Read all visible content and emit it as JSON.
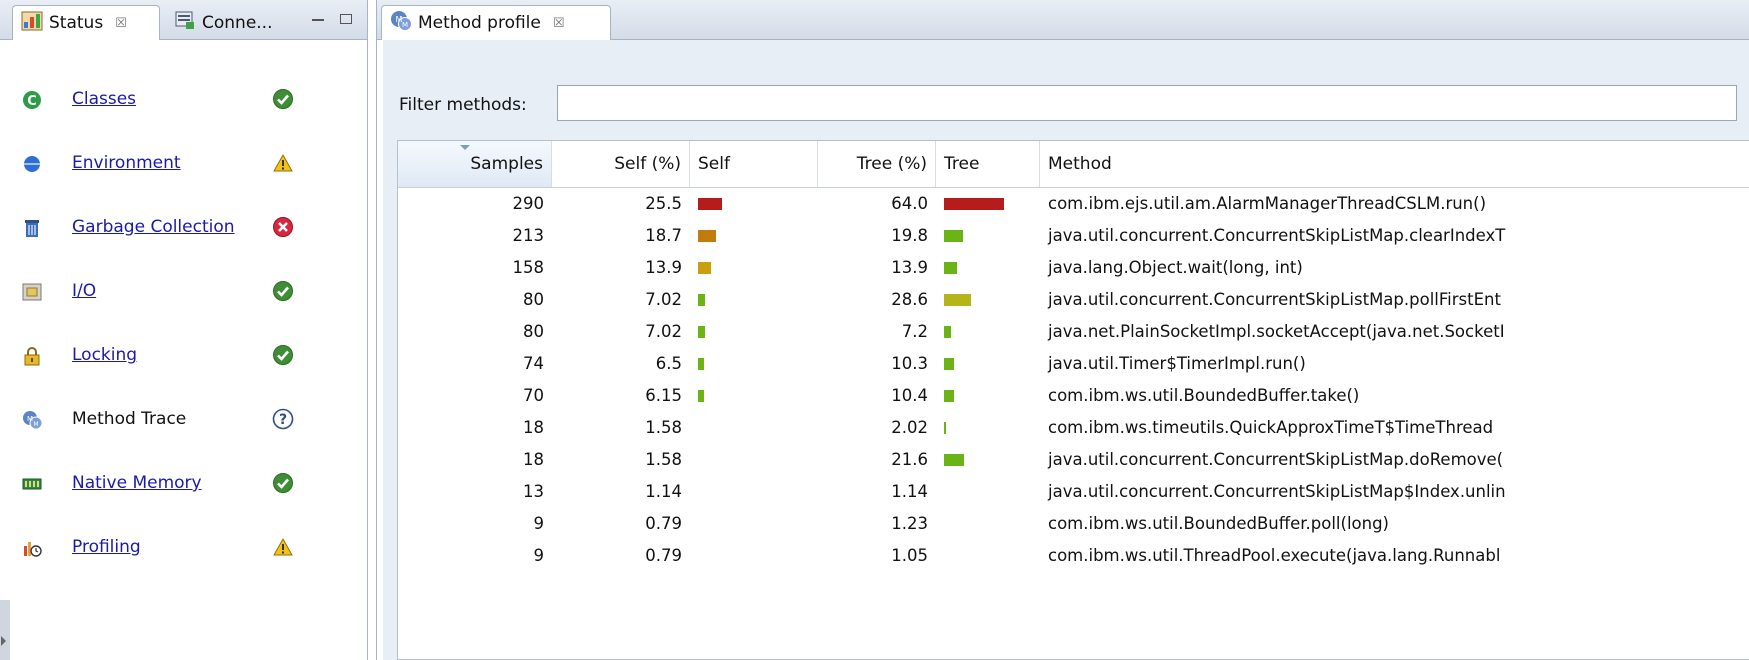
{
  "colors": {
    "bar_high": "#b71c1c",
    "bar_orange": "#c27c0e",
    "bar_gold": "#c9a00c",
    "bar_olive": "#b5b41a",
    "bar_green": "#6ab417"
  },
  "left_panel": {
    "tabs": [
      {
        "label": "Status",
        "close": "☒"
      },
      {
        "label": "Conne...",
        "close": ""
      }
    ],
    "items": [
      {
        "label": "Classes",
        "icon": "classes-icon",
        "status": "ok",
        "link": true
      },
      {
        "label": "Environment",
        "icon": "environment-icon",
        "status": "warning",
        "link": true
      },
      {
        "label": "Garbage Collection",
        "icon": "garbage-collection-icon",
        "status": "error",
        "link": true
      },
      {
        "label": "I/O",
        "icon": "io-icon",
        "status": "ok",
        "link": true
      },
      {
        "label": "Locking",
        "icon": "locking-icon",
        "status": "ok",
        "link": true
      },
      {
        "label": "Method Trace",
        "icon": "method-trace-icon",
        "status": "unknown",
        "link": false
      },
      {
        "label": "Native Memory",
        "icon": "native-memory-icon",
        "status": "ok",
        "link": true
      },
      {
        "label": "Profiling",
        "icon": "profiling-icon",
        "status": "warning",
        "link": true
      }
    ]
  },
  "right_panel": {
    "tab": {
      "label": "Method profile",
      "close": "☒"
    },
    "filter": {
      "label": "Filter methods:",
      "value": ""
    },
    "columns": [
      "Samples",
      "Self (%)",
      "Self",
      "Tree (%)",
      "Tree",
      "Method"
    ],
    "rows": [
      {
        "samples": "290",
        "self_pct": "25.5",
        "self_bar": 25.5,
        "self_color": "#b71c1c",
        "tree_pct": "64.0",
        "tree_bar": 64.0,
        "tree_color": "#b71c1c",
        "method": "com.ibm.ejs.util.am.AlarmManagerThreadCSLM.run()"
      },
      {
        "samples": "213",
        "self_pct": "18.7",
        "self_bar": 18.7,
        "self_color": "#c27c0e",
        "tree_pct": "19.8",
        "tree_bar": 19.8,
        "tree_color": "#6ab417",
        "method": "java.util.concurrent.ConcurrentSkipListMap.clearIndexT"
      },
      {
        "samples": "158",
        "self_pct": "13.9",
        "self_bar": 13.9,
        "self_color": "#c9a00c",
        "tree_pct": "13.9",
        "tree_bar": 13.9,
        "tree_color": "#6ab417",
        "method": "java.lang.Object.wait(long, int)"
      },
      {
        "samples": "80",
        "self_pct": "7.02",
        "self_bar": 7.02,
        "self_color": "#6ab417",
        "tree_pct": "28.6",
        "tree_bar": 28.6,
        "tree_color": "#b5b41a",
        "method": "java.util.concurrent.ConcurrentSkipListMap.pollFirstEnt"
      },
      {
        "samples": "80",
        "self_pct": "7.02",
        "self_bar": 7.02,
        "self_color": "#6ab417",
        "tree_pct": "7.2",
        "tree_bar": 7.2,
        "tree_color": "#6ab417",
        "method": "java.net.PlainSocketImpl.socketAccept(java.net.SocketI"
      },
      {
        "samples": "74",
        "self_pct": "6.5",
        "self_bar": 6.5,
        "self_color": "#6ab417",
        "tree_pct": "10.3",
        "tree_bar": 10.3,
        "tree_color": "#6ab417",
        "method": "java.util.Timer$TimerImpl.run()"
      },
      {
        "samples": "70",
        "self_pct": "6.15",
        "self_bar": 6.15,
        "self_color": "#6ab417",
        "tree_pct": "10.4",
        "tree_bar": 10.4,
        "tree_color": "#6ab417",
        "method": "com.ibm.ws.util.BoundedBuffer.take()"
      },
      {
        "samples": "18",
        "self_pct": "1.58",
        "self_bar": 0,
        "self_color": "#6ab417",
        "tree_pct": "2.02",
        "tree_bar": 2.02,
        "tree_color": "#6ab417",
        "method": "com.ibm.ws.timeutils.QuickApproxTimeT$TimeThread"
      },
      {
        "samples": "18",
        "self_pct": "1.58",
        "self_bar": 0,
        "self_color": "#6ab417",
        "tree_pct": "21.6",
        "tree_bar": 21.6,
        "tree_color": "#6ab417",
        "method": "java.util.concurrent.ConcurrentSkipListMap.doRemove("
      },
      {
        "samples": "13",
        "self_pct": "1.14",
        "self_bar": 0,
        "self_color": "#6ab417",
        "tree_pct": "1.14",
        "tree_bar": 0,
        "tree_color": "#6ab417",
        "method": "java.util.concurrent.ConcurrentSkipListMap$Index.unlin"
      },
      {
        "samples": "9",
        "self_pct": "0.79",
        "self_bar": 0,
        "self_color": "#6ab417",
        "tree_pct": "1.23",
        "tree_bar": 0,
        "tree_color": "#6ab417",
        "method": "com.ibm.ws.util.BoundedBuffer.poll(long)"
      },
      {
        "samples": "9",
        "self_pct": "0.79",
        "self_bar": 0,
        "self_color": "#6ab417",
        "tree_pct": "1.05",
        "tree_bar": 0,
        "tree_color": "#6ab417",
        "method": "com.ibm.ws.util.ThreadPool.execute(java.lang.Runnabl"
      }
    ]
  }
}
